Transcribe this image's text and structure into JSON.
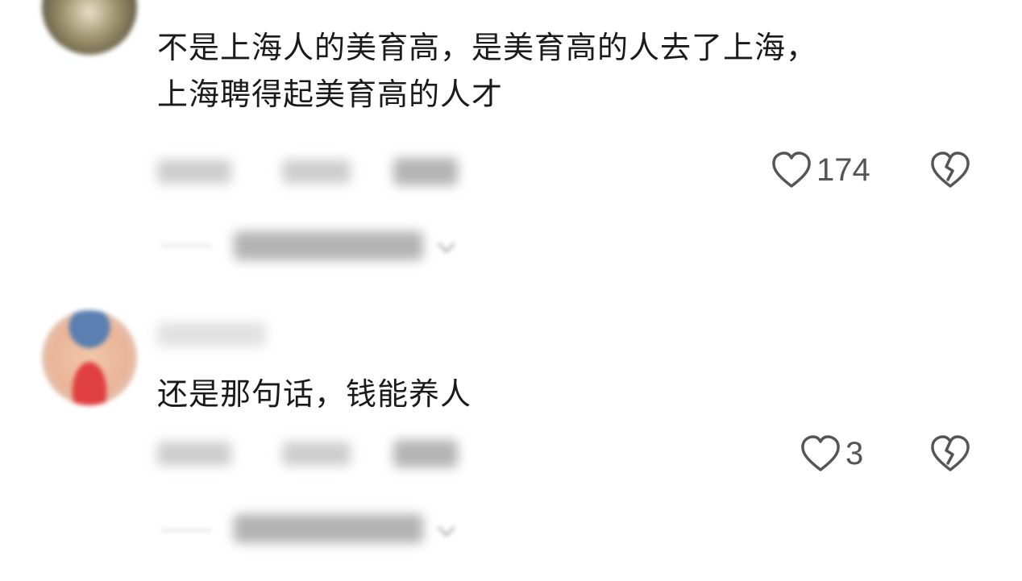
{
  "comments": [
    {
      "text_lines": [
        "不是上海人的美育高，是美育高的人去了上海，",
        "上海聘得起美育高的人才"
      ],
      "likes": "174"
    },
    {
      "text_lines": [
        "还是那句话，钱能养人"
      ],
      "likes": "3"
    }
  ],
  "icons": {
    "like": "heart-outline-icon",
    "dislike": "broken-heart-icon",
    "expand": "chevron-down-icon"
  }
}
